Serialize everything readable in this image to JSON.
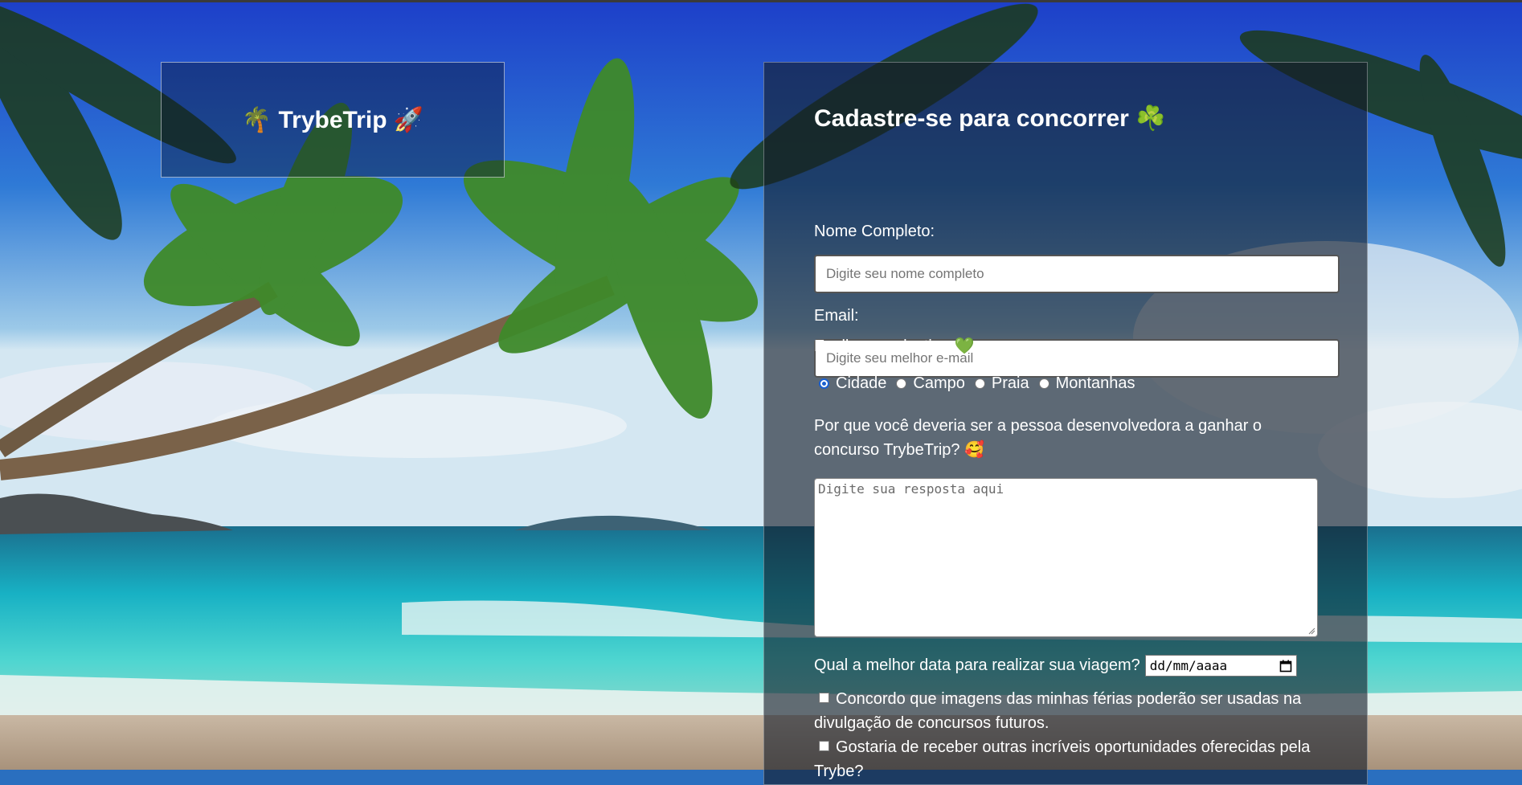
{
  "header": {
    "logo_text": "🌴 TrybeTrip 🚀"
  },
  "form": {
    "title": "Cadastre-se para concorrer ☘️",
    "name_label": "Nome Completo:",
    "name_placeholder": "Digite seu nome completo",
    "email_label": "Email:",
    "email_placeholder": "Digite seu melhor e-mail",
    "destination_label": "Ecolha seu destino 💚",
    "destinations": [
      {
        "label": "Cidade",
        "checked": true
      },
      {
        "label": "Campo",
        "checked": false
      },
      {
        "label": "Praia",
        "checked": false
      },
      {
        "label": "Montanhas",
        "checked": false
      }
    ],
    "question": "Por que você deveria ser a pessoa desenvolvedora a ganhar o concurso TrybeTrip? 🥰",
    "answer_placeholder": "Digite sua resposta aqui",
    "date_label": "Qual a melhor data para realizar sua viagem?",
    "date_value": "dd/mm/aaaa",
    "checkbox_images": "Concordo que imagens das minhas férias poderão ser usadas na divulgação de concursos futuros.",
    "checkbox_opportunities": "Gostaria de receber outras incríveis oportunidades oferecidas pela Trybe?"
  }
}
